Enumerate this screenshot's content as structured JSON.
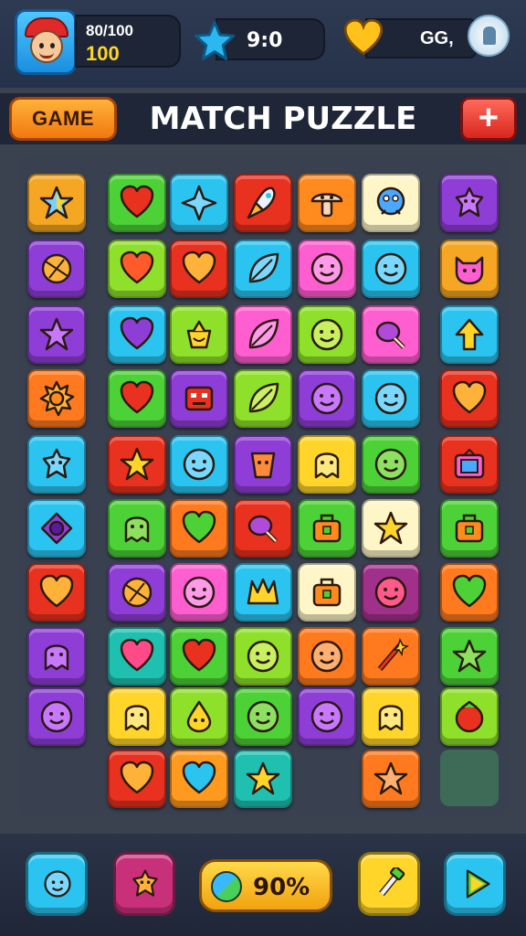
{
  "header": {
    "xp_label": "80/100",
    "coins": "100",
    "score": "9:0",
    "lives_label": "GG,"
  },
  "titlebar": {
    "game_button": "GAME",
    "title": "MATCH PUZZLE",
    "plus_button": "+"
  },
  "icons": {
    "avatar": "avatar-icon",
    "star": "star-icon",
    "heart": "heart-icon",
    "add_life": "shield-icon"
  },
  "board": {
    "tiles": [
      {
        "col": 0,
        "row": 0,
        "color": "#f5a623",
        "icon": "rainbow-star"
      },
      {
        "col": 1,
        "row": 0,
        "color": "#4cd137",
        "icon": "heart"
      },
      {
        "col": 2,
        "row": 0,
        "color": "#2bc4f0",
        "icon": "sparkle"
      },
      {
        "col": 3,
        "row": 0,
        "color": "#e8311e",
        "icon": "rocket"
      },
      {
        "col": 4,
        "row": 0,
        "color": "#ff8a1e",
        "icon": "mushroom"
      },
      {
        "col": 5,
        "row": 0,
        "color": "#fff6c8",
        "icon": "monster"
      },
      {
        "col": 6,
        "row": 0,
        "color": "#8e3ed6",
        "icon": "creature"
      },
      {
        "col": 0,
        "row": 1,
        "color": "#8e3ed6",
        "icon": "ball"
      },
      {
        "col": 1,
        "row": 1,
        "color": "#8ee02a",
        "icon": "heart"
      },
      {
        "col": 2,
        "row": 1,
        "color": "#e8311e",
        "icon": "heart"
      },
      {
        "col": 3,
        "row": 1,
        "color": "#2bc4f0",
        "icon": "leaf"
      },
      {
        "col": 4,
        "row": 1,
        "color": "#ff5ed0",
        "icon": "smiley"
      },
      {
        "col": 5,
        "row": 1,
        "color": "#2bc4f0",
        "icon": "smiley"
      },
      {
        "col": 6,
        "row": 1,
        "color": "#f5a623",
        "icon": "cat"
      },
      {
        "col": 0,
        "row": 2,
        "color": "#8e3ed6",
        "icon": "star"
      },
      {
        "col": 1,
        "row": 2,
        "color": "#2bc4f0",
        "icon": "heart"
      },
      {
        "col": 2,
        "row": 2,
        "color": "#8ee02a",
        "icon": "pot"
      },
      {
        "col": 3,
        "row": 2,
        "color": "#ff5ed0",
        "icon": "leaf"
      },
      {
        "col": 4,
        "row": 2,
        "color": "#8ee02a",
        "icon": "smiley"
      },
      {
        "col": 5,
        "row": 2,
        "color": "#ff5ed0",
        "icon": "drumstick"
      },
      {
        "col": 6,
        "row": 2,
        "color": "#2bc4f0",
        "icon": "arrow"
      },
      {
        "col": 0,
        "row": 3,
        "color": "#ff7a1e",
        "icon": "sun"
      },
      {
        "col": 1,
        "row": 3,
        "color": "#4cd137",
        "icon": "heart"
      },
      {
        "col": 2,
        "row": 3,
        "color": "#8e3ed6",
        "icon": "robot"
      },
      {
        "col": 3,
        "row": 3,
        "color": "#8ee02a",
        "icon": "leaf"
      },
      {
        "col": 4,
        "row": 3,
        "color": "#8e3ed6",
        "icon": "smiley"
      },
      {
        "col": 5,
        "row": 3,
        "color": "#2bc4f0",
        "icon": "smiley"
      },
      {
        "col": 6,
        "row": 3,
        "color": "#e8311e",
        "icon": "heart"
      },
      {
        "col": 0,
        "row": 4,
        "color": "#2bc4f0",
        "icon": "creature"
      },
      {
        "col": 1,
        "row": 4,
        "color": "#e8311e",
        "icon": "star"
      },
      {
        "col": 2,
        "row": 4,
        "color": "#2bc4f0",
        "icon": "smiley"
      },
      {
        "col": 3,
        "row": 4,
        "color": "#8e3ed6",
        "icon": "cup"
      },
      {
        "col": 4,
        "row": 4,
        "color": "#ffd52a",
        "icon": "ghost"
      },
      {
        "col": 5,
        "row": 4,
        "color": "#4cd137",
        "icon": "smiley"
      },
      {
        "col": 6,
        "row": 4,
        "color": "#e8311e",
        "icon": "tv"
      },
      {
        "col": 0,
        "row": 5,
        "color": "#2bc4f0",
        "icon": "eye"
      },
      {
        "col": 1,
        "row": 5,
        "color": "#4cd137",
        "icon": "ghost"
      },
      {
        "col": 2,
        "row": 5,
        "color": "#ff7a1e",
        "icon": "heart"
      },
      {
        "col": 3,
        "row": 5,
        "color": "#e8311e",
        "icon": "drumstick"
      },
      {
        "col": 4,
        "row": 5,
        "color": "#4cd137",
        "icon": "bag"
      },
      {
        "col": 5,
        "row": 5,
        "color": "#fff6c8",
        "icon": "star"
      },
      {
        "col": 6,
        "row": 5,
        "color": "#4cd137",
        "icon": "bag"
      },
      {
        "col": 0,
        "row": 6,
        "color": "#e8311e",
        "icon": "heart"
      },
      {
        "col": 1,
        "row": 6,
        "color": "#8e3ed6",
        "icon": "ball"
      },
      {
        "col": 2,
        "row": 6,
        "color": "#ff5ed0",
        "icon": "smiley"
      },
      {
        "col": 3,
        "row": 6,
        "color": "#2bc4f0",
        "icon": "crown"
      },
      {
        "col": 4,
        "row": 6,
        "color": "#fff6c8",
        "icon": "bag"
      },
      {
        "col": 5,
        "row": 6,
        "color": "#a0308a",
        "icon": "smiley"
      },
      {
        "col": 6,
        "row": 6,
        "color": "#ff7a1e",
        "icon": "heart"
      },
      {
        "col": 0,
        "row": 7,
        "color": "#8e3ed6",
        "icon": "ghost"
      },
      {
        "col": 1,
        "row": 7,
        "color": "#20c0b0",
        "icon": "heart"
      },
      {
        "col": 2,
        "row": 7,
        "color": "#4cd137",
        "icon": "heart"
      },
      {
        "col": 3,
        "row": 7,
        "color": "#8ee02a",
        "icon": "smiley"
      },
      {
        "col": 4,
        "row": 7,
        "color": "#ff7a1e",
        "icon": "smiley"
      },
      {
        "col": 5,
        "row": 7,
        "color": "#ff7a1e",
        "icon": "wand"
      },
      {
        "col": 6,
        "row": 7,
        "color": "#4cd137",
        "icon": "star"
      },
      {
        "col": 0,
        "row": 8,
        "color": "#8e3ed6",
        "icon": "smiley"
      },
      {
        "col": 1,
        "row": 8,
        "color": "#ffd52a",
        "icon": "ghost"
      },
      {
        "col": 2,
        "row": 8,
        "color": "#8ee02a",
        "icon": "drop"
      },
      {
        "col": 3,
        "row": 8,
        "color": "#4cd137",
        "icon": "smiley"
      },
      {
        "col": 4,
        "row": 8,
        "color": "#8e3ed6",
        "icon": "smiley"
      },
      {
        "col": 5,
        "row": 8,
        "color": "#ffd52a",
        "icon": "ghost"
      },
      {
        "col": 6,
        "row": 8,
        "color": "#8ee02a",
        "icon": "berry"
      },
      {
        "col": 1,
        "row": 9,
        "color": "#e8311e",
        "icon": "heart"
      },
      {
        "col": 2,
        "row": 9,
        "color": "#ff9a1e",
        "icon": "heart"
      },
      {
        "col": 3,
        "row": 9,
        "color": "#20c0b0",
        "icon": "star"
      },
      {
        "col": 5,
        "row": 9,
        "color": "#ff7a1e",
        "icon": "star"
      }
    ]
  },
  "bottombar": {
    "buttons": [
      {
        "name": "hint-face-button",
        "color": "#2bc4f0",
        "icon": "face"
      },
      {
        "name": "swap-creature-button",
        "color": "#c8307a",
        "icon": "creature"
      },
      {
        "name": "hammer-button",
        "color": "#ffd52a",
        "icon": "hammer"
      },
      {
        "name": "play-button",
        "color": "#2bc4f0",
        "icon": "play"
      }
    ],
    "progress": "90%"
  }
}
